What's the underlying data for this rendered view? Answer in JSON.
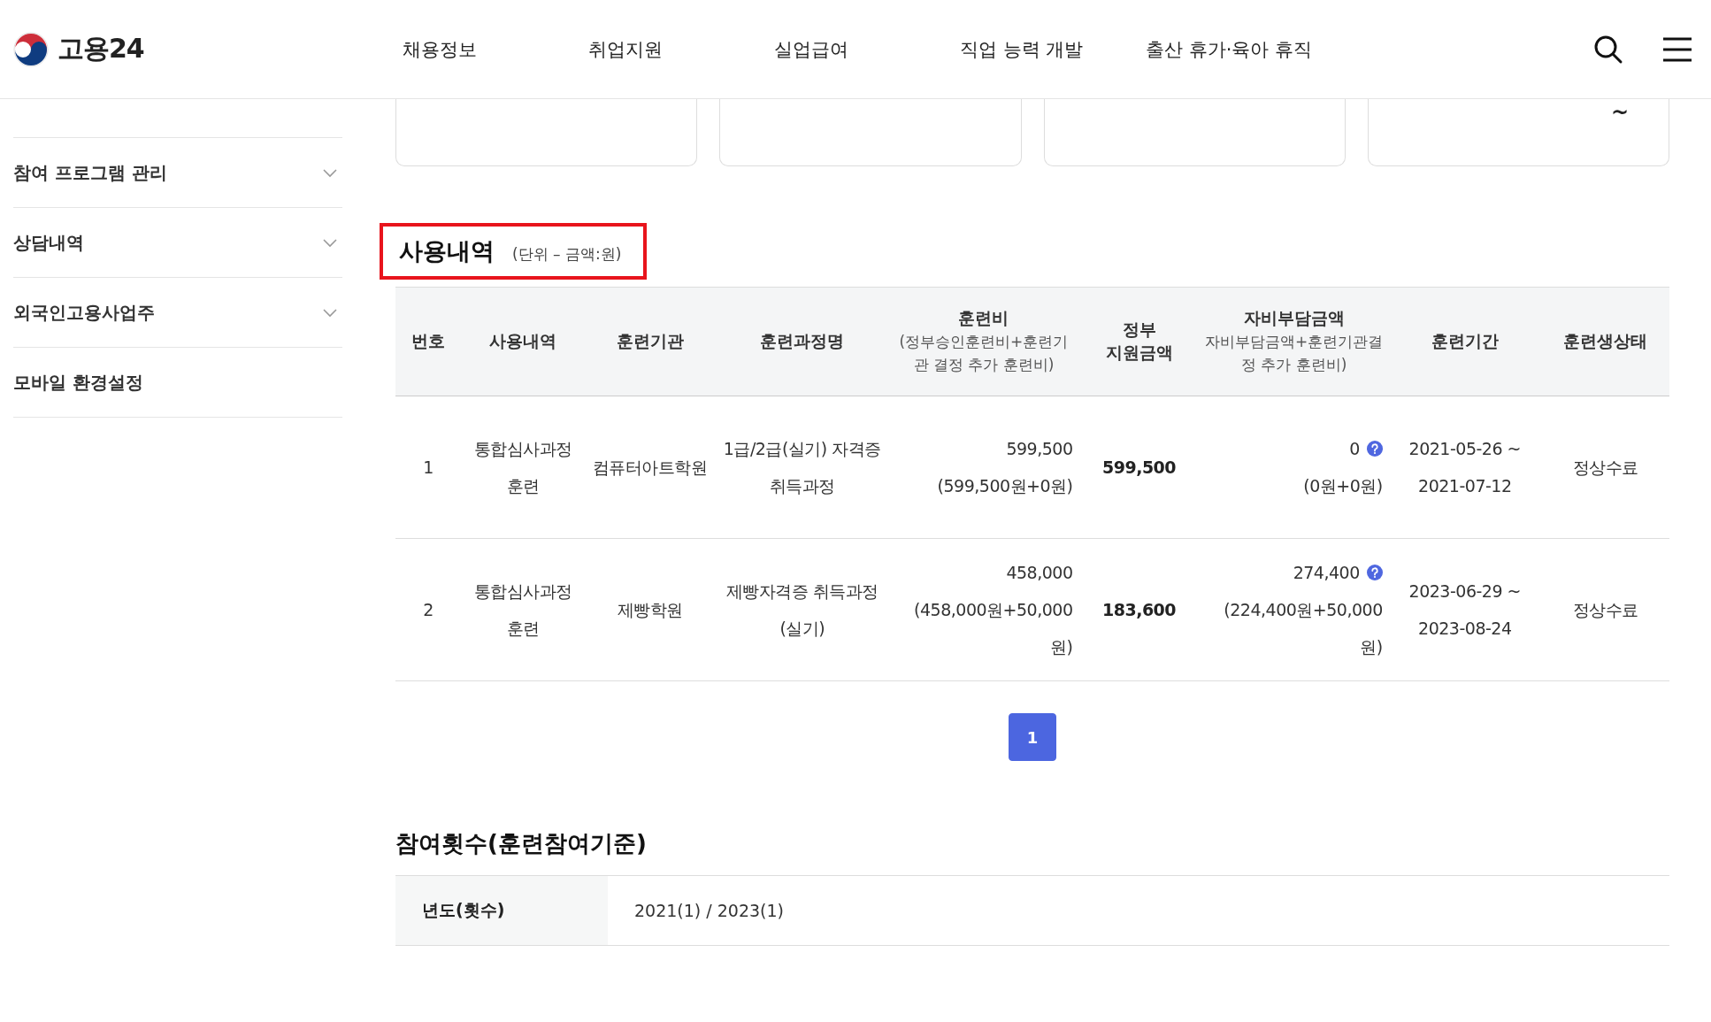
{
  "header": {
    "logo_text": "고용24",
    "nav": [
      {
        "label": "채용정보"
      },
      {
        "label": "취업지원"
      },
      {
        "label": "실업급여"
      },
      {
        "label": "직업 능력 개발"
      },
      {
        "label": "출산 휴가·육아 휴직"
      }
    ]
  },
  "sidebar": {
    "items": [
      {
        "label": "참여 프로그램 관리",
        "expandable": true
      },
      {
        "label": "상담내역",
        "expandable": true
      },
      {
        "label": "외국인고용사업주",
        "expandable": true
      },
      {
        "label": "모바일 환경설정",
        "expandable": false
      }
    ]
  },
  "summary_cards": [
    {
      "kind": "blank"
    },
    {
      "kind": "blank"
    },
    {
      "kind": "blank"
    },
    {
      "kind": "text",
      "text": "~"
    }
  ],
  "usage": {
    "title": "사용내역",
    "unit": "(단위 – 금액:원)",
    "highlighted": true,
    "columns": [
      {
        "title": "번호"
      },
      {
        "title": "사용내역"
      },
      {
        "title": "훈련기관"
      },
      {
        "title": "훈련과정명"
      },
      {
        "title": "훈련비",
        "subtitle": "(정부승인훈련비+훈련기관 결정 추가 훈련비)"
      },
      {
        "title": "정부\n지원금액"
      },
      {
        "title": "자비부담금액",
        "subtitle": "자비부담금액+훈련기관결정 추가 훈련비)"
      },
      {
        "title": "훈련기간"
      },
      {
        "title": "훈련생상태"
      }
    ],
    "rows": [
      {
        "no": "1",
        "usage": "통합심사과정 훈련",
        "institution": "컴퓨터아트학원",
        "course": "1급/2급(실기) 자격증 취득과정",
        "fee": "599,500",
        "fee_detail": "(599,500원+0원)",
        "gov": "599,500",
        "self": "0",
        "self_detail": "(0원+0원)",
        "period": "2021-05-26 ~ 2021-07-12",
        "status": "정상수료"
      },
      {
        "no": "2",
        "usage": "통합심사과정 훈련",
        "institution": "제빵학원",
        "course": "제빵자격증 취득과정(실기)",
        "fee": "458,000",
        "fee_detail": "(458,000원+50,000원)",
        "gov": "183,600",
        "self": "274,400",
        "self_detail": "(224,400원+50,000원)",
        "period": "2023-06-29 ~ 2023-08-24",
        "status": "정상수료"
      }
    ]
  },
  "pagination": [
    {
      "label": "1",
      "selected": true
    }
  ],
  "participation": {
    "title": "참여횟수(훈련참여기준)",
    "label": "년도(횟수)",
    "value": "2021(1) / 2023(1)"
  }
}
